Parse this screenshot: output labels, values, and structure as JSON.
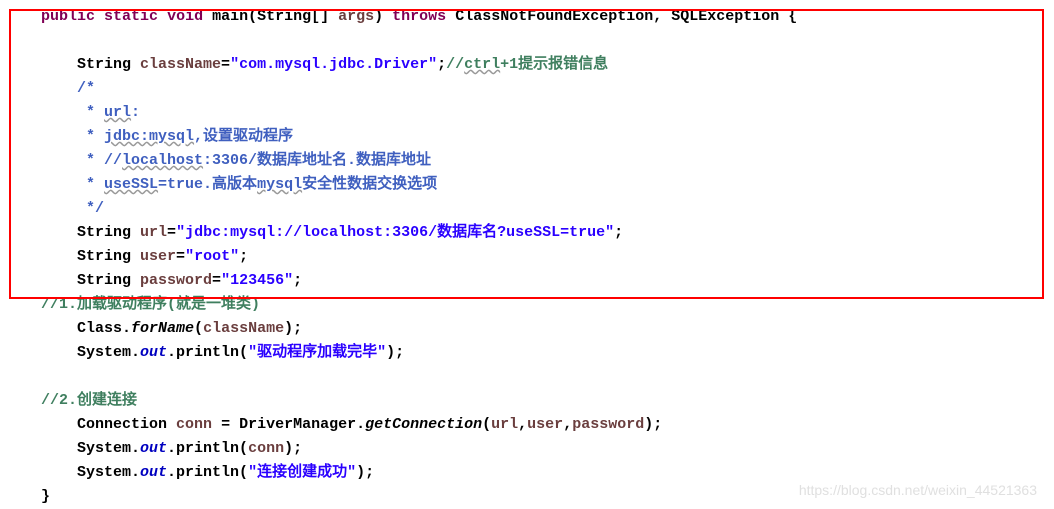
{
  "code": {
    "line1": {
      "kw_public": "public",
      "kw_static": "static",
      "kw_void": "void",
      "method": "main(String[] ",
      "args": "args",
      "close_paren": ") ",
      "kw_throws": "throws",
      "exceptions": " ClassNotFoundException, SQLException {"
    },
    "line2": {
      "indent": "        ",
      "type": "String ",
      "var": "className",
      "eq": "=",
      "str": "\"com.mysql.jdbc.Driver\"",
      "semi": ";",
      "comment_prefix": "//",
      "ctrl": "ctrl",
      "comment_suffix": "+1提示报错信息"
    },
    "line3": {
      "indent": "        ",
      "text": "/*"
    },
    "line4": {
      "indent": "         ",
      "prefix": "* ",
      "url": "url",
      "colon": ":"
    },
    "line5": {
      "indent": "         ",
      "prefix": "* ",
      "jdbc": "jdbc:mysql",
      "suffix": ",设置驱动程序"
    },
    "line6": {
      "indent": "         ",
      "prefix": "* //",
      "localhost": "localhost",
      "suffix": ":3306/数据库地址名.数据库地址"
    },
    "line7": {
      "indent": "         ",
      "prefix": "* ",
      "usessl": "useSSL",
      "eq_true": "=true.高版本",
      "mysql": "mysql",
      "suffix": "安全性数据交换选项"
    },
    "line8": {
      "indent": "         ",
      "text": "*/"
    },
    "line9": {
      "indent": "        ",
      "type": "String ",
      "var": "url",
      "eq": "=",
      "str": "\"jdbc:mysql://localhost:3306/数据库名?useSSL=true\"",
      "semi": ";"
    },
    "line10": {
      "indent": "        ",
      "type": "String ",
      "var": "user",
      "eq": "=",
      "str": "\"root\"",
      "semi": ";"
    },
    "line11": {
      "indent": "        ",
      "type": "String ",
      "var": "password",
      "eq": "=",
      "str": "\"123456\"",
      "semi": ";"
    },
    "line12": {
      "indent": "    ",
      "text": "//1.加载驱动程序(就是一堆类)"
    },
    "line13": {
      "indent": "        ",
      "text1": "Class.",
      "forname": "forName",
      "text2": "(",
      "var": "className",
      "text3": ");"
    },
    "line14": {
      "indent": "        ",
      "text1": "System.",
      "out": "out",
      "text2": ".println(",
      "str": "\"驱动程序加载完毕\"",
      "text3": ");"
    },
    "line15": {
      "indent": "    ",
      "text": "//2.创建连接"
    },
    "line16": {
      "indent": "        ",
      "text1": "Connection ",
      "var": "conn",
      "text2": " = DriverManager.",
      "getconn": "getConnection",
      "text3": "(",
      "url": "url",
      "comma1": ",",
      "user": "user",
      "comma2": ",",
      "password": "password",
      "text4": ");"
    },
    "line17": {
      "indent": "        ",
      "text1": "System.",
      "out": "out",
      "text2": ".println(",
      "var": "conn",
      "text3": ");"
    },
    "line18": {
      "indent": "        ",
      "text1": "System.",
      "out": "out",
      "text2": ".println(",
      "str": "\"连接创建成功\"",
      "text3": ");"
    },
    "line19": {
      "indent": "    ",
      "text": "}"
    }
  },
  "watermark": "https://blog.csdn.net/weixin_44521363"
}
